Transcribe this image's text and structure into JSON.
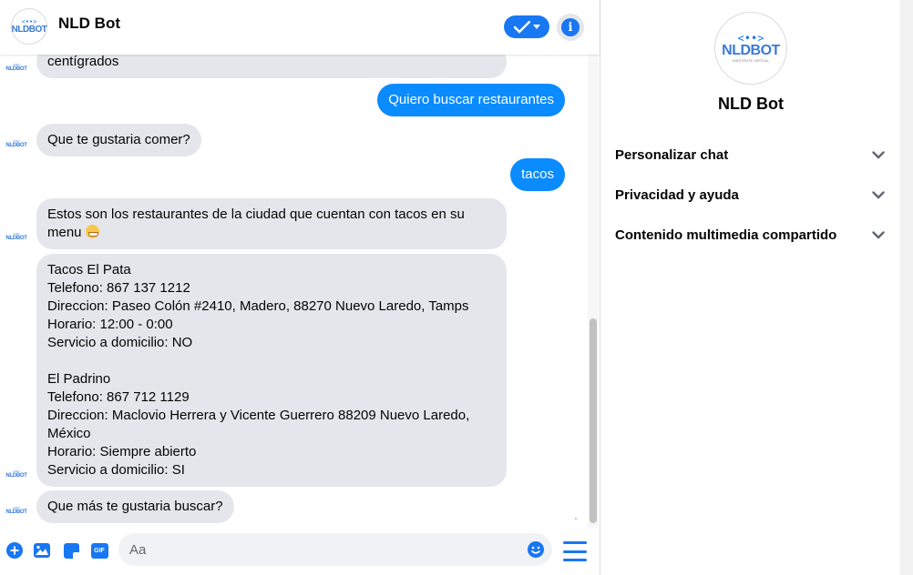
{
  "header": {
    "bot_name": "NLD Bot",
    "logo_text": "NLDBOT"
  },
  "messages": {
    "m0": {
      "sender": "bot",
      "text": "centígrados"
    },
    "m1": {
      "sender": "user",
      "text": "Quiero buscar restaurantes"
    },
    "m2": {
      "sender": "bot",
      "text": "Que te gustaria comer?"
    },
    "m3": {
      "sender": "user",
      "text": "tacos"
    },
    "m4": {
      "sender": "bot",
      "text": "Estos son los restaurantes de la ciudad que cuentan con tacos en su\nmenu"
    },
    "m5": {
      "sender": "bot",
      "text": "Tacos El Pata\nTelefono: 867 137 1212\nDireccion: Paseo Colón #2410, Madero, 88270 Nuevo Laredo, Tamps\nHorario: 12:00 - 0:00\nServicio a domicilio: NO\n\nEl Padrino\nTelefono: 867 712 1129\nDireccion: Maclovio Herrera y Vicente Guerrero 88209 Nuevo Laredo,\nMéxico\nHorario: Siempre abierto\nServicio a domicilio: SI"
    },
    "m6": {
      "sender": "bot",
      "text": "Que más te gustaria buscar?"
    }
  },
  "composer": {
    "placeholder": "Aa",
    "gif_label": "GIF"
  },
  "panel": {
    "name": "NLD Bot",
    "logo_text": "NLDBOT",
    "logo_subtext": "ASISTENTE VIRTUAL",
    "sections": [
      {
        "label": "Personalizar chat"
      },
      {
        "label": "Privacidad y ayuda"
      },
      {
        "label": "Contenido multimedia compartido"
      }
    ]
  },
  "colors": {
    "accent": "#1877f2",
    "user_bubble": "#0a8bff",
    "bot_bubble": "#e4e6eb"
  }
}
